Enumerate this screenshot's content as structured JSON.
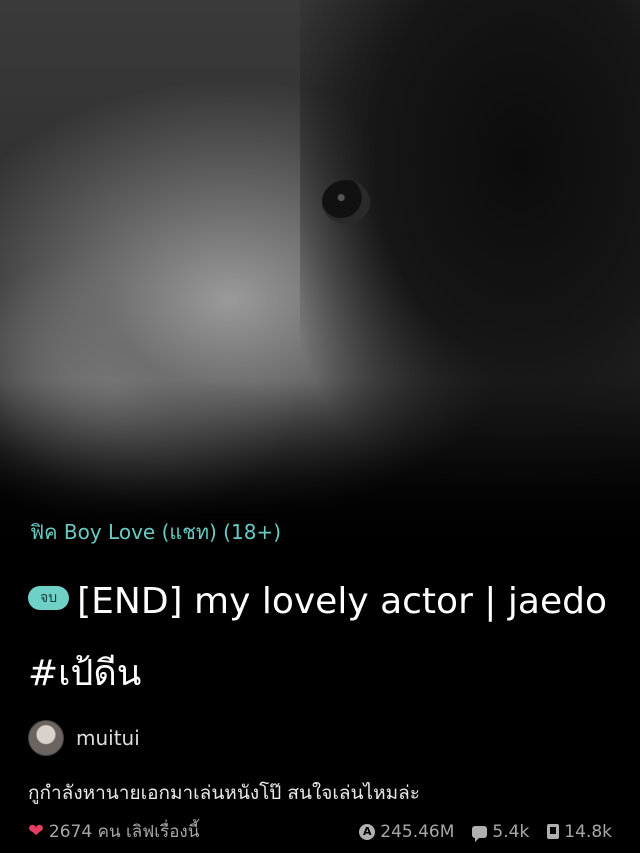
{
  "story": {
    "category": "ฟิค Boy Love (แชท) (18+)",
    "status_badge": "จบ",
    "title": "[END] my lovely actor | jaedo #เป้ดีน",
    "author": "muitui",
    "description": "กูกำลังหานายเอกมาเล่นหนังโป๊ สนใจเล่นไหมล่ะ"
  },
  "stats": {
    "likes": "2674 คน เลิฟเรื่องนี้",
    "views": "245.46M",
    "comments": "5.4k",
    "chapters": "14.8k"
  },
  "colors": {
    "accent": "#66cbc3",
    "badge_bg": "#6fd0c8",
    "heart": "#e23d62",
    "background": "#000000"
  },
  "icons": {
    "likes": "heart-icon",
    "views": "views-icon",
    "comments": "comment-icon",
    "chapters": "book-icon"
  }
}
